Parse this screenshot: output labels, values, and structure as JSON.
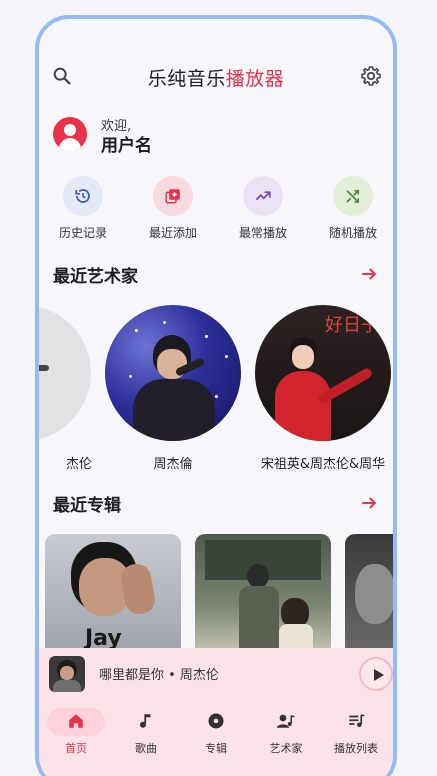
{
  "header": {
    "title_main": "乐纯音乐",
    "title_accent": "播放器"
  },
  "user": {
    "welcome": "欢迎,",
    "name": "用户名"
  },
  "actions": [
    {
      "label": "历史记录",
      "icon": "history-icon",
      "color": "#3e5fb8",
      "bg": "#e4e9f8"
    },
    {
      "label": "最近添加",
      "icon": "playlist-add-icon",
      "color": "#e8334a",
      "bg": "#fadbe0"
    },
    {
      "label": "最常播放",
      "icon": "trending-up-icon",
      "color": "#7a4bb5",
      "bg": "#ece2f6"
    },
    {
      "label": "随机播放",
      "icon": "shuffle-icon",
      "color": "#4d8a3a",
      "bg": "#e3efd9"
    }
  ],
  "sections": {
    "artists": "最近艺术家",
    "albums": "最近专辑"
  },
  "artists": [
    {
      "name": "杰伦"
    },
    {
      "name": "周杰倫"
    },
    {
      "name": "宋祖英&周杰伦&周华"
    }
  ],
  "now_playing": {
    "text": "哪里都是你 • 周杰伦"
  },
  "nav": [
    {
      "label": "首页",
      "icon": "home-icon",
      "active": true
    },
    {
      "label": "歌曲",
      "icon": "music-note-icon"
    },
    {
      "label": "专辑",
      "icon": "album-icon"
    },
    {
      "label": "艺术家",
      "icon": "artist-icon"
    },
    {
      "label": "播放列表",
      "icon": "playlist-icon"
    }
  ],
  "colors": {
    "accent": "#e8334a",
    "frame": "#93bdf2",
    "bar": "#fce3ea"
  }
}
